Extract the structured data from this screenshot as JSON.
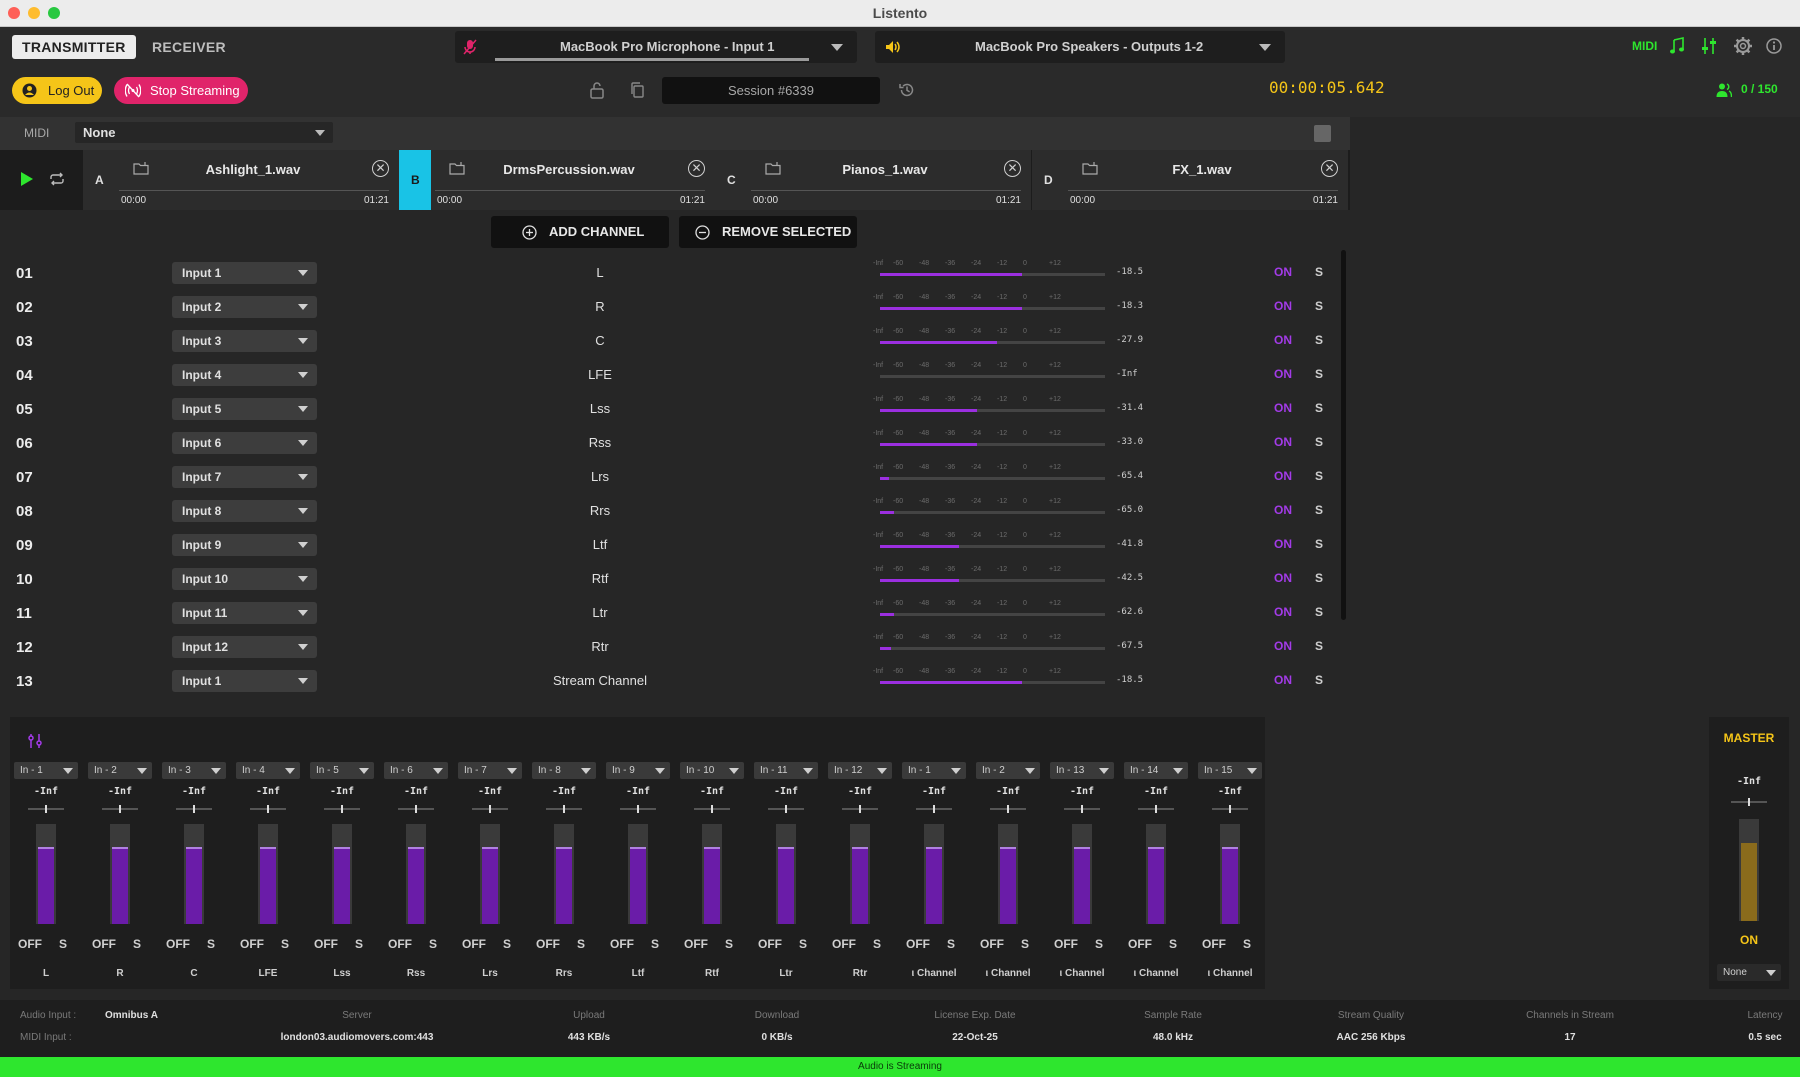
{
  "app_title": "Listento",
  "header": {
    "tab_transmitter": "TRANSMITTER",
    "tab_receiver": "RECEIVER",
    "input_device": "MacBook Pro Microphone - Input 1",
    "output_device": "MacBook Pro Speakers - Outputs 1-2",
    "midi_label": "MIDI"
  },
  "session_bar": {
    "logout": "Log Out",
    "stop_streaming": "Stop Streaming",
    "session": "Session #6339",
    "timecode": "00:00:05.642",
    "listeners": "0 / 150"
  },
  "midi_row": {
    "label": "MIDI",
    "value": "None"
  },
  "players": [
    {
      "slot": "A",
      "file": "Ashlight_1.wav",
      "start": "00:00",
      "end": "01:21"
    },
    {
      "slot": "B",
      "file": "DrmsPercussion.wav",
      "start": "00:00",
      "end": "01:21"
    },
    {
      "slot": "C",
      "file": "Pianos_1.wav",
      "start": "00:00",
      "end": "01:21"
    },
    {
      "slot": "D",
      "file": "FX_1.wav",
      "start": "00:00",
      "end": "01:21"
    }
  ],
  "channel_actions": {
    "add": "ADD CHANNEL",
    "remove": "REMOVE SELECTED"
  },
  "meter_scale": [
    "-Inf",
    "-60",
    "-48",
    "-36",
    "-24",
    "-12",
    "0",
    "+12"
  ],
  "channels": [
    {
      "num": "01",
      "input": "Input 1",
      "name": "L",
      "level": "-18.5",
      "fill": 0.63,
      "on": "ON",
      "solo": "S"
    },
    {
      "num": "02",
      "input": "Input 2",
      "name": "R",
      "level": "-18.3",
      "fill": 0.63,
      "on": "ON",
      "solo": "S"
    },
    {
      "num": "03",
      "input": "Input 3",
      "name": "C",
      "level": "-27.9",
      "fill": 0.52,
      "on": "ON",
      "solo": "S"
    },
    {
      "num": "04",
      "input": "Input 4",
      "name": "LFE",
      "level": "-Inf",
      "fill": 0.0,
      "on": "ON",
      "solo": "S"
    },
    {
      "num": "05",
      "input": "Input 5",
      "name": "Lss",
      "level": "-31.4",
      "fill": 0.43,
      "on": "ON",
      "solo": "S"
    },
    {
      "num": "06",
      "input": "Input 6",
      "name": "Rss",
      "level": "-33.0",
      "fill": 0.43,
      "on": "ON",
      "solo": "S"
    },
    {
      "num": "07",
      "input": "Input 7",
      "name": "Lrs",
      "level": "-65.4",
      "fill": 0.04,
      "on": "ON",
      "solo": "S"
    },
    {
      "num": "08",
      "input": "Input 8",
      "name": "Rrs",
      "level": "-65.0",
      "fill": 0.06,
      "on": "ON",
      "solo": "S"
    },
    {
      "num": "09",
      "input": "Input 9",
      "name": "Ltf",
      "level": "-41.8",
      "fill": 0.35,
      "on": "ON",
      "solo": "S"
    },
    {
      "num": "10",
      "input": "Input 10",
      "name": "Rtf",
      "level": "-42.5",
      "fill": 0.35,
      "on": "ON",
      "solo": "S"
    },
    {
      "num": "11",
      "input": "Input 11",
      "name": "Ltr",
      "level": "-62.6",
      "fill": 0.06,
      "on": "ON",
      "solo": "S"
    },
    {
      "num": "12",
      "input": "Input 12",
      "name": "Rtr",
      "level": "-67.5",
      "fill": 0.05,
      "on": "ON",
      "solo": "S"
    },
    {
      "num": "13",
      "input": "Input 1",
      "name": "Stream Channel",
      "level": "-18.5",
      "fill": 0.63,
      "on": "ON",
      "solo": "S"
    }
  ],
  "mixer": {
    "strips": [
      {
        "input": "In - 1",
        "gain": "-Inf",
        "off": "OFF",
        "solo": "S",
        "label": "L",
        "level": 0.78
      },
      {
        "input": "In - 2",
        "gain": "-Inf",
        "off": "OFF",
        "solo": "S",
        "label": "R",
        "level": 0.78
      },
      {
        "input": "In - 3",
        "gain": "-Inf",
        "off": "OFF",
        "solo": "S",
        "label": "C",
        "level": 0.78
      },
      {
        "input": "In - 4",
        "gain": "-Inf",
        "off": "OFF",
        "solo": "S",
        "label": "LFE",
        "level": 0.78
      },
      {
        "input": "In - 5",
        "gain": "-Inf",
        "off": "OFF",
        "solo": "S",
        "label": "Lss",
        "level": 0.78
      },
      {
        "input": "In - 6",
        "gain": "-Inf",
        "off": "OFF",
        "solo": "S",
        "label": "Rss",
        "level": 0.78
      },
      {
        "input": "In - 7",
        "gain": "-Inf",
        "off": "OFF",
        "solo": "S",
        "label": "Lrs",
        "level": 0.78
      },
      {
        "input": "In - 8",
        "gain": "-Inf",
        "off": "OFF",
        "solo": "S",
        "label": "Rrs",
        "level": 0.78
      },
      {
        "input": "In - 9",
        "gain": "-Inf",
        "off": "OFF",
        "solo": "S",
        "label": "Ltf",
        "level": 0.78
      },
      {
        "input": "In - 10",
        "gain": "-Inf",
        "off": "OFF",
        "solo": "S",
        "label": "Rtf",
        "level": 0.78
      },
      {
        "input": "In - 11",
        "gain": "-Inf",
        "off": "OFF",
        "solo": "S",
        "label": "Ltr",
        "level": 0.78
      },
      {
        "input": "In - 12",
        "gain": "-Inf",
        "off": "OFF",
        "solo": "S",
        "label": "Rtr",
        "level": 0.78
      },
      {
        "input": "In - 1",
        "gain": "-Inf",
        "off": "OFF",
        "solo": "S",
        "label": "ι Channel",
        "level": 0.78
      },
      {
        "input": "In - 2",
        "gain": "-Inf",
        "off": "OFF",
        "solo": "S",
        "label": "ι Channel",
        "level": 0.78
      },
      {
        "input": "In - 13",
        "gain": "-Inf",
        "off": "OFF",
        "solo": "S",
        "label": "ι Channel",
        "level": 0.78
      },
      {
        "input": "In - 14",
        "gain": "-Inf",
        "off": "OFF",
        "solo": "S",
        "label": "ι Channel",
        "level": 0.78
      },
      {
        "input": "In - 15",
        "gain": "-Inf",
        "off": "OFF",
        "solo": "S",
        "label": "ι Channel",
        "level": 0.78
      }
    ],
    "master": {
      "title": "MASTER",
      "gain": "-Inf",
      "on": "ON",
      "select": "None",
      "level": 0.8
    }
  },
  "footer": {
    "audio_input_label": "Audio Input :",
    "audio_input_value": "Omnibus A",
    "midi_input_label": "MIDI Input :",
    "server_label": "Server",
    "server": "london03.audiomovers.com:443",
    "upload_label": "Upload",
    "upload": "443 KB/s",
    "download_label": "Download",
    "download": "0 KB/s",
    "license_label": "License Exp. Date",
    "license": "22-Oct-25",
    "sample_rate_label": "Sample Rate",
    "sample_rate": "48.0 kHz",
    "quality_label": "Stream Quality",
    "quality": "AAC 256 Kbps",
    "channels_label": "Channels in Stream",
    "channels": "17",
    "latency_label": "Latency",
    "latency": "0.5 sec",
    "status": "Audio is Streaming"
  },
  "colors": {
    "accent_purple": "#a33be8",
    "accent_green": "#2ee62e",
    "accent_yellow": "#f5c518",
    "accent_pink": "#e0246a",
    "accent_cyan": "#19c3e6"
  }
}
